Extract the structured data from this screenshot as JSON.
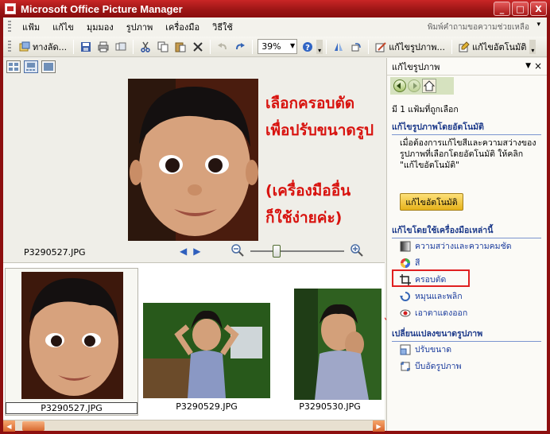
{
  "window": {
    "title": "Microsoft Office Picture Manager",
    "buttons": [
      "_",
      "□",
      "X"
    ]
  },
  "menu": {
    "items": [
      "แฟ้ม",
      "แก้ไข",
      "มุมมอง",
      "รูปภาพ",
      "เครื่องมือ",
      "วิธีใช้"
    ],
    "help_placeholder": "พิมพ์คำถามขอความช่วยเหลือ"
  },
  "toolbar": {
    "shortcuts_label": "ทางลัด...",
    "zoom_value": "39%",
    "edit_pictures_label": "แก้ไขรูปภาพ...",
    "auto_correct_label": "แก้ไขอัตโนมัติ"
  },
  "preview": {
    "filename": "P3290527.JPG",
    "overlay": [
      "เลือกครอบตัด",
      "เพื่อปรับขนาดรูป",
      "(เครื่องมืออื่น",
      "ก็ใช้ง่ายค่ะ)"
    ],
    "zoom_level": 0.28
  },
  "thumbnails": [
    {
      "filename": "P3290527.JPG",
      "selected": true
    },
    {
      "filename": "P3290529.JPG",
      "selected": false
    },
    {
      "filename": "P3290530.JPG",
      "selected": false
    }
  ],
  "taskpane": {
    "title": "แก้ไขรูปภาพ",
    "selected_count": "มี 1 แฟ้มที่ถูกเลือก",
    "auto_section": "แก้ไขรูปภาพโดยอัตโนมัติ",
    "auto_desc": "เมื่อต้องการแก้ไขสีและความสว่างของรูปภาพที่เลือกโดยอัตโนมัติ ให้คลิก \"แก้ไขอัตโนมัติ\"",
    "auto_button": "แก้ไขอัตโนมัติ",
    "tools_section": "แก้ไขโดยใช้เครื่องมือเหล่านี้",
    "tools": [
      "ความสว่างและความคมชัด",
      "สี",
      "ครอบตัด",
      "หมุนและพลิก",
      "เอาตาแดงออก"
    ],
    "resize_section": "เปลี่ยนแปลงขนาดรูปภาพ",
    "resize_tools": [
      "ปรับขนาด",
      "บีบอัดรูปภาพ"
    ]
  },
  "colors": {
    "title_bar": "#b31b1b",
    "annotation_red": "#d8120e",
    "task_link": "#1b3c9d",
    "section_heading": "#1d3a8a"
  }
}
